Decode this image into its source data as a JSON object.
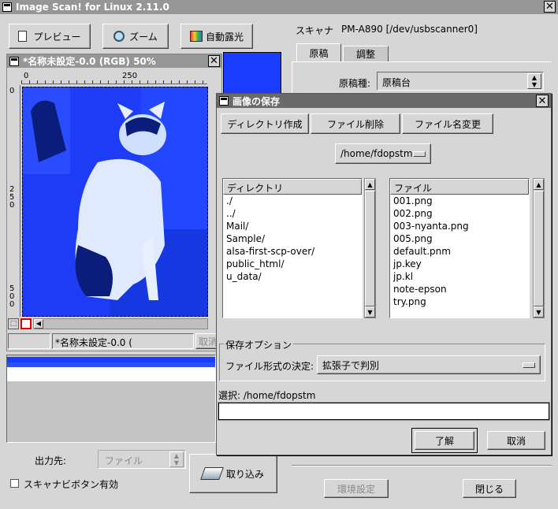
{
  "main_window": {
    "title": "Image Scan! for Linux 2.11.0",
    "toolbar": {
      "preview_label": "プレビュー",
      "zoom_label": "ズーム",
      "auto_exposure_label": "自動露光"
    },
    "scanner_label": "スキャナ",
    "scanner_value": "PM-A890 [/dev/usbscanner0]",
    "tabs": [
      {
        "label": "原稿"
      },
      {
        "label": "調整"
      }
    ],
    "document_source_label": "原稿種:",
    "document_source_value": "原稿台",
    "output_label": "出力先:",
    "output_value": "ファイル",
    "scanner_button_checkbox_label": "スキャナビボタン有効",
    "scan_button_label": "取り込み",
    "env_settings_label": "環境設定",
    "close_label": "閉じる"
  },
  "preview_window": {
    "title": "*名称未設定-0.0 (RGB) 50%",
    "ruler_ticks": {
      "h0": "0",
      "h250": "250",
      "v0": "0",
      "v250": "2 5 0",
      "v500": "5 0 0"
    },
    "status_text": "*名称未設定-0.0 (",
    "cancel_label": "取消"
  },
  "save_dialog": {
    "title": "画像の保存",
    "buttons": {
      "mkdir": "ディレクトリ作成",
      "delete": "ファイル削除",
      "rename": "ファイル名変更"
    },
    "path_menu": "/home/fdopstm",
    "dir_header": "ディレクトリ",
    "file_header": "ファイル",
    "directories": [
      {
        "name": "./"
      },
      {
        "name": "../"
      },
      {
        "name": "Mail/"
      },
      {
        "name": "Sample/"
      },
      {
        "name": "alsa-first-scp-over/"
      },
      {
        "name": "public_html/"
      },
      {
        "name": "u_data/"
      }
    ],
    "files": [
      {
        "name": "001.png"
      },
      {
        "name": "002.png"
      },
      {
        "name": "003-nyanta.png"
      },
      {
        "name": "005.png"
      },
      {
        "name": "default.pnm"
      },
      {
        "name": "jp.key"
      },
      {
        "name": "jp.kl"
      },
      {
        "name": "note-epson"
      },
      {
        "name": "try.png"
      }
    ],
    "save_options_label": "保存オプション",
    "format_label": "ファイル形式の決定:",
    "format_value": "拡張子で判別",
    "selection_label": "選択: /home/fdopstm",
    "filename_value": "",
    "ok_label": "了解",
    "cancel_label": "取消"
  },
  "colors": {
    "preview_blue": "#1a3cff",
    "title_inactive": "#969696",
    "title_active": "#6a6a6a"
  },
  "icons": [
    "document-icon",
    "magnifier-icon",
    "palette-icon",
    "scanner-icon",
    "window-menu-icon",
    "close-icon"
  ]
}
